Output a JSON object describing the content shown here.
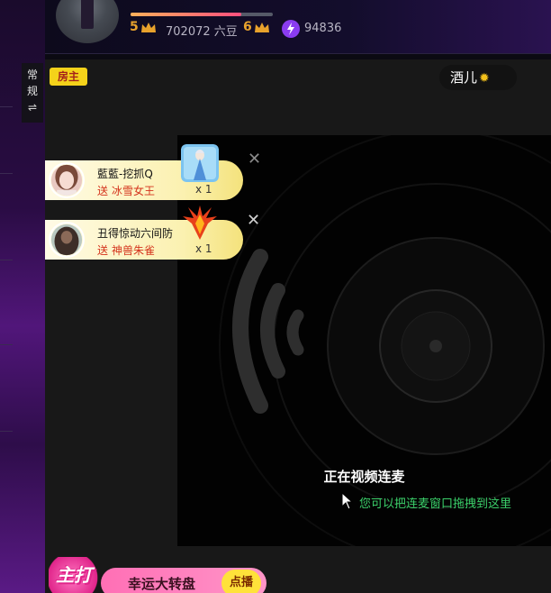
{
  "sidebar": {
    "mode_label_line1": "常",
    "mode_label_line2": "规",
    "switch_glyph": "⇌"
  },
  "header": {
    "level_progress": 0.78,
    "current_level": "5",
    "next_level": "6",
    "beans_text": "702072 六豆",
    "points_text": "94836",
    "crown_icon": "crown-icon",
    "bolt_icon": "lightning-icon",
    "bolt_color": "#8a3cf0"
  },
  "room": {
    "owner_badge": "房主",
    "host_name": "酒儿",
    "host_name_icon": "sun-icon"
  },
  "gifts": [
    {
      "sender": "藍藍-挖抓Q",
      "verb": "送",
      "gift_name": "冰雪女王",
      "count": "x 1",
      "gift_icon": "ice-queen-gift-icon"
    },
    {
      "sender": "丑得惊动六间防",
      "verb": "送",
      "gift_name": "神兽朱雀",
      "count": "x 1",
      "gift_icon": "phoenix-gift-icon"
    }
  ],
  "video": {
    "status_title": "正在视频连麦",
    "hint_text": "您可以把连麦窗口拖拽到这里",
    "hint_color": "#3bd06a"
  },
  "promo": {
    "tag_text": "主打",
    "title": "幸运大转盘",
    "cta_label": "点播"
  },
  "colors": {
    "owner_badge_bg": "#f4d21a",
    "accent_pink": "#ff6fb5",
    "level_color": "#e8a22c"
  }
}
